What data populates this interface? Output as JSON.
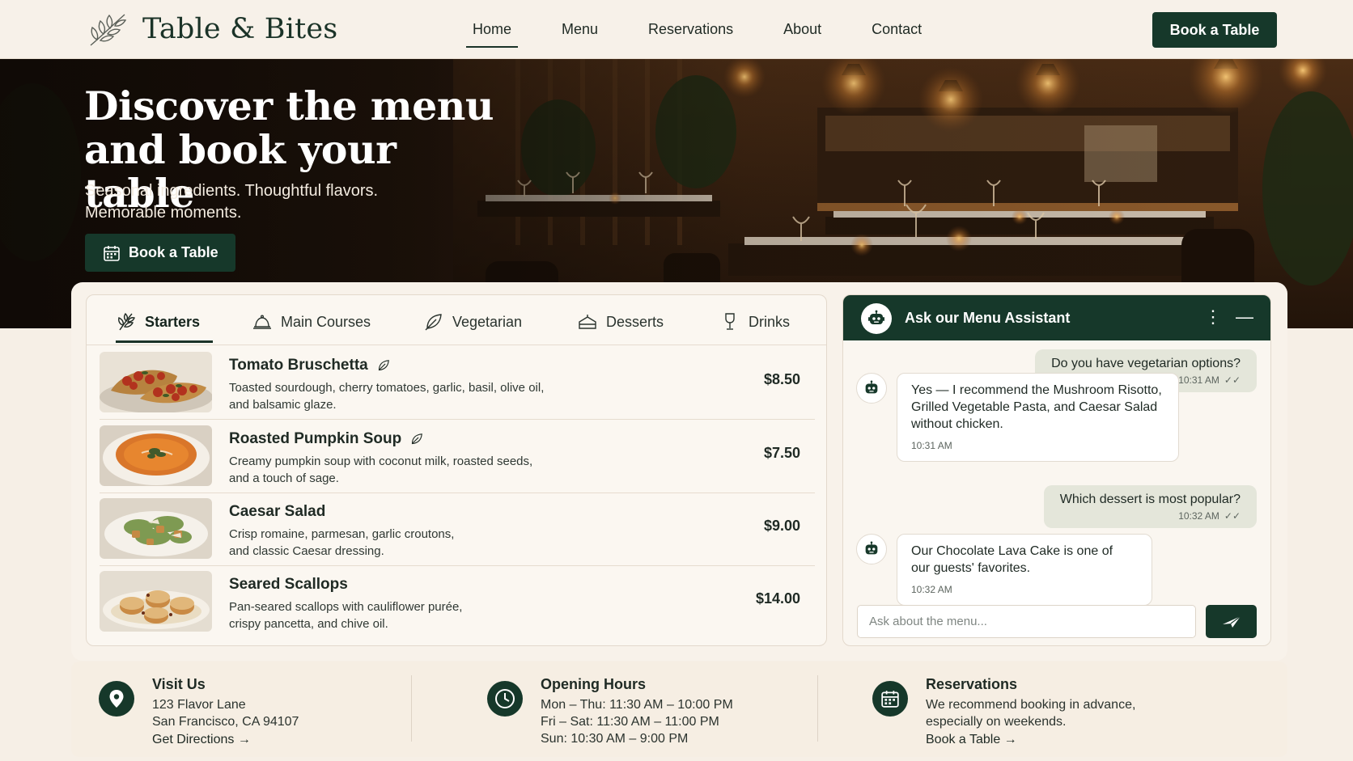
{
  "brand": {
    "name": "Table & Bites",
    "logo_icon": "olive-branch-icon"
  },
  "nav": {
    "items": [
      "Home",
      "Menu",
      "Reservations",
      "About",
      "Contact"
    ],
    "active": "Home",
    "cta_label": "Book a Table"
  },
  "hero": {
    "title_line1": "Discover the menu",
    "title_line2": "and book your table",
    "subtitle_line1": "Seasonal ingredients. Thoughtful flavors.",
    "subtitle_line2": "Memorable moments.",
    "cta_label": "Book a Table",
    "cta_icon": "calendar-icon"
  },
  "menu": {
    "tabs": [
      {
        "label": "Starters",
        "icon": "herb-icon",
        "active": true
      },
      {
        "label": "Main Courses",
        "icon": "cloche-icon",
        "active": false
      },
      {
        "label": "Vegetarian",
        "icon": "leaf-icon",
        "active": false
      },
      {
        "label": "Desserts",
        "icon": "cake-icon",
        "active": false
      },
      {
        "label": "Drinks",
        "icon": "glass-icon",
        "active": false
      }
    ],
    "items": [
      {
        "name": "Tomato Bruschetta",
        "vegetarian": true,
        "desc_line1": "Toasted sourdough, cherry tomatoes, garlic, basil, olive oil,",
        "desc_line2": "and balsamic glaze.",
        "price": "$8.50"
      },
      {
        "name": "Roasted Pumpkin Soup",
        "vegetarian": true,
        "desc_line1": "Creamy pumpkin soup with coconut milk, roasted seeds,",
        "desc_line2": "and a touch of sage.",
        "price": "$7.50"
      },
      {
        "name": "Caesar Salad",
        "vegetarian": false,
        "desc_line1": "Crisp romaine, parmesan, garlic croutons,",
        "desc_line2": "and classic Caesar dressing.",
        "price": "$9.00"
      },
      {
        "name": "Seared Scallops",
        "vegetarian": false,
        "desc_line1": "Pan-seared scallops with cauliflower purée,",
        "desc_line2": "crispy pancetta, and chive oil.",
        "price": "$14.00"
      }
    ]
  },
  "chat": {
    "title": "Ask our Menu Assistant",
    "messages": [
      {
        "from": "user",
        "text": "Do you have vegetarian options?",
        "time": "10:31 AM"
      },
      {
        "from": "bot",
        "lines": [
          "Yes — I recommend the Mushroom Risotto,",
          "Grilled Vegetable Pasta, and Caesar Salad",
          "without chicken."
        ],
        "time": "10:31 AM"
      },
      {
        "from": "user",
        "text": "Which dessert is most popular?",
        "time": "10:32 AM"
      },
      {
        "from": "bot",
        "lines": [
          "Our Chocolate Lava Cake is one of",
          "our guests' favorites."
        ],
        "time": "10:32 AM"
      }
    ],
    "input_placeholder": "Ask about the menu...",
    "send_icon": "paper-plane-icon"
  },
  "info": {
    "visit": {
      "title": "Visit Us",
      "line1": "123 Flavor Lane",
      "line2": "San Francisco, CA 94107",
      "link": "Get Directions",
      "icon": "map-pin-icon"
    },
    "hours": {
      "title": "Opening Hours",
      "line1": "Mon – Thu: 11:30 AM – 10:00 PM",
      "line2": "Fri – Sat: 11:30 AM – 11:00 PM",
      "line3": "Sun: 10:30 AM – 9:00 PM",
      "icon": "clock-icon"
    },
    "reservations": {
      "title": "Reservations",
      "line1": "We recommend booking in advance,",
      "line2": "especially on weekends.",
      "link": "Book a Table",
      "icon": "calendar-icon"
    }
  },
  "colors": {
    "primary": "#16382a",
    "background": "#f6efe6",
    "bubble_user": "#e4e6da"
  }
}
